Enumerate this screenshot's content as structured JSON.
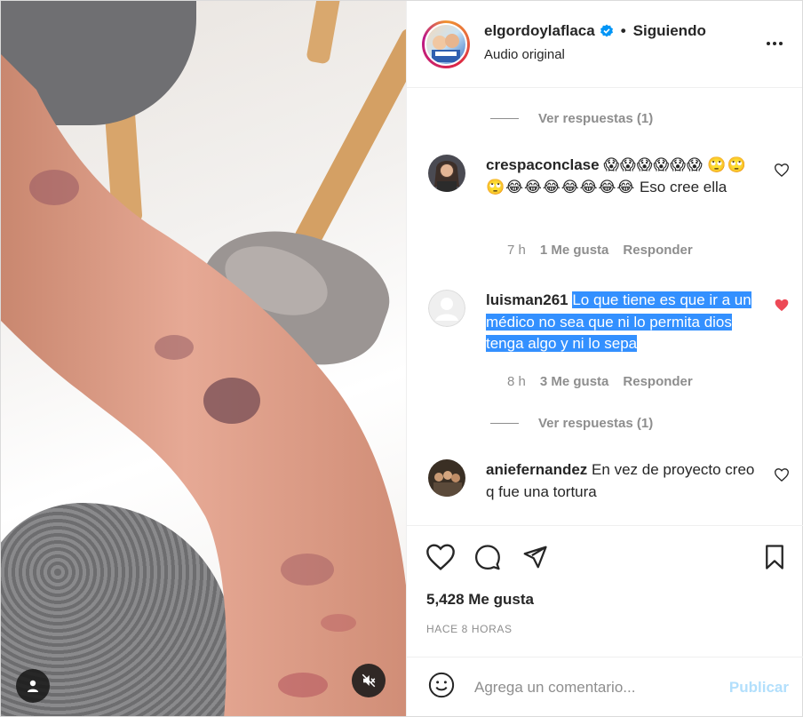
{
  "header": {
    "username": "elgordoylaflaca",
    "separator": "•",
    "following_label": "Siguiendo",
    "audio_label": "Audio original"
  },
  "comments": [
    {
      "type": "view_replies",
      "label": "Ver respuestas (1)"
    },
    {
      "username": "crespaconclase",
      "emojis": "😱😱😱😱😱😱",
      "emojis2": "🙄🙄🙄😂😂😂😂😂😂😂",
      "text": "Eso cree ella",
      "time": "7 h",
      "likes": "1 Me gusta",
      "reply": "Responder",
      "liked": false
    },
    {
      "username": "luisman261",
      "text": "Lo que tiene es que ir a un médico no sea que ni lo permita dios tenga algo y ni lo sepa",
      "time": "8 h",
      "likes": "3 Me gusta",
      "reply": "Responder",
      "liked": true
    },
    {
      "type": "view_replies",
      "label": "Ver respuestas (1)"
    },
    {
      "username": "aniefernandez",
      "text": "En vez de proyecto creo q fue una tortura",
      "liked": false
    }
  ],
  "actions": {
    "likes_count": "5,428 Me gusta",
    "time_ago": "HACE 8 HORAS"
  },
  "composer": {
    "placeholder": "Agrega un comentario...",
    "publish_label": "Publicar"
  },
  "colors": {
    "verified_blue": "#0095f6",
    "liked_red": "#ed4956",
    "highlight_blue": "#3390ff",
    "publish_disabled": "#b2dffc"
  }
}
